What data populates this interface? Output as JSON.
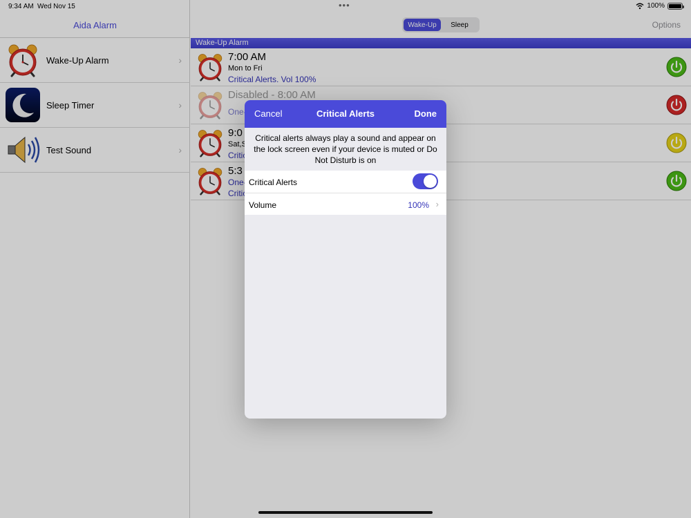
{
  "status_bar": {
    "time": "9:34 AM",
    "date": "Wed Nov 15",
    "battery": "100%"
  },
  "sidebar": {
    "title": "Aida Alarm",
    "items": [
      {
        "label": "Wake-Up Alarm",
        "icon": "alarm-clock-icon"
      },
      {
        "label": "Sleep Timer",
        "icon": "moon-icon"
      },
      {
        "label": "Test Sound",
        "icon": "speaker-icon"
      }
    ]
  },
  "detail": {
    "segments": [
      "Wake-Up",
      "Sleep"
    ],
    "selected_segment": "Wake-Up",
    "options_label": "Options",
    "section_title": "Wake-Up Alarm",
    "alarms": [
      {
        "time": "7:00 AM",
        "days": "Mon to Fri",
        "sub": "Critical Alerts. Vol 100%",
        "power_color": "#4cbb17",
        "enabled": true
      },
      {
        "time": "Disabled - 8:00 AM",
        "days": "",
        "sub": "One-",
        "power_color": "#d62a2a",
        "enabled": false
      },
      {
        "time": "9:0",
        "days": "Sat,S",
        "sub": "Critic",
        "power_color": "#e6d21a",
        "enabled": true
      },
      {
        "time": "5:3",
        "days": "",
        "sub": "One-",
        "sub2": "Critic",
        "power_color": "#4cbb17",
        "enabled": true
      }
    ]
  },
  "modal": {
    "cancel_label": "Cancel",
    "title": "Critical Alerts",
    "done_label": "Done",
    "description": "Critical alerts always play a sound and appear on the lock screen even if your device is muted or Do Not Disturb is on",
    "toggle_label": "Critical Alerts",
    "toggle_on": true,
    "volume_label": "Volume",
    "volume_value": "100%"
  },
  "colors": {
    "accent": "#4a4ad9",
    "link": "#3434b8"
  }
}
